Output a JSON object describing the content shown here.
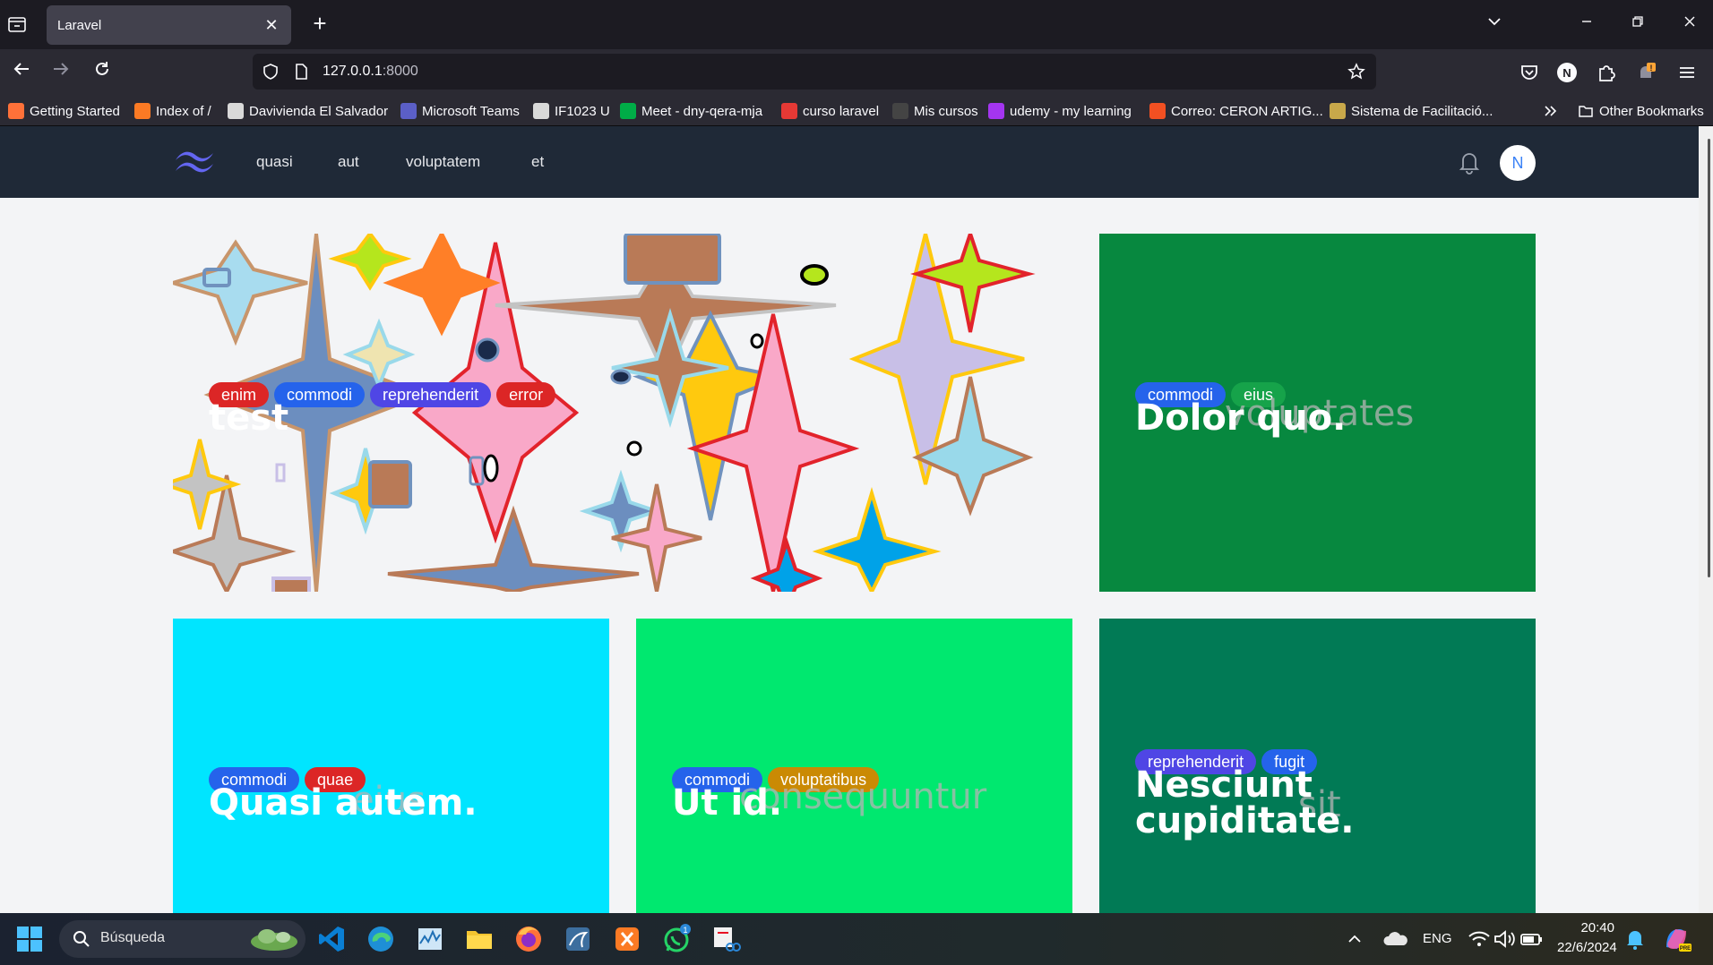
{
  "browser": {
    "tab_title": "Laravel",
    "url_host": "127.0.0.1",
    "url_port": ":8000",
    "bookmarks": [
      {
        "label": "Getting Started",
        "color": "#ff7139"
      },
      {
        "label": "Index of /",
        "color": "#fb7a24"
      },
      {
        "label": "Davivienda El Salvador",
        "color": "#d9d9d9"
      },
      {
        "label": "Microsoft Teams",
        "color": "#5b5fc7"
      },
      {
        "label": "IF1023 U",
        "color": "#d9d9d9"
      },
      {
        "label": "Meet - dny-qera-mja",
        "color": "#00ac47"
      },
      {
        "label": "curso laravel",
        "color": "#e53935"
      },
      {
        "label": "Mis cursos",
        "color": "#444444"
      },
      {
        "label": "udemy - my learning",
        "color": "#a435f0"
      },
      {
        "label": "Correo: CERON ARTIG...",
        "color": "#f25022"
      },
      {
        "label": "Sistema de Facilitació...",
        "color": "#c8a84a"
      }
    ],
    "other_bookmarks": "Other Bookmarks"
  },
  "app": {
    "nav_links": [
      "quasi",
      "aut",
      "voluptatem",
      "et"
    ],
    "avatar_initial": "N",
    "logo_color": "#6366f1"
  },
  "posts": [
    {
      "title": "test",
      "ghost": "",
      "bg": "image",
      "tags": [
        {
          "label": "enim",
          "color": "#dc2626"
        },
        {
          "label": "commodi",
          "color": "#2563eb"
        },
        {
          "label": "reprehenderit",
          "color": "#4f46e5"
        },
        {
          "label": "error",
          "color": "#dc2626"
        }
      ]
    },
    {
      "title": "Dolor quo.",
      "ghost": "voluptates",
      "bg": "#07883f",
      "tags": [
        {
          "label": "commodi",
          "color": "#2563eb"
        },
        {
          "label": "eius",
          "color": "#16a34a"
        }
      ]
    },
    {
      "title": "Quasi autem.",
      "ghost": "eius",
      "bg": "#00e5ff",
      "tags": [
        {
          "label": "commodi",
          "color": "#2563eb"
        },
        {
          "label": "quae",
          "color": "#dc2626"
        }
      ]
    },
    {
      "title": "Ut id.",
      "ghost": "consequuntur",
      "bg": "#00e86f",
      "tags": [
        {
          "label": "commodi",
          "color": "#2563eb"
        },
        {
          "label": "voluptatibus",
          "color": "#ca8a04"
        }
      ]
    },
    {
      "title": "Nesciunt cupiditate.",
      "ghost": "sit",
      "bg": "#017a55",
      "tags": [
        {
          "label": "reprehenderit",
          "color": "#4f46e5"
        },
        {
          "label": "fugit",
          "color": "#2563eb"
        }
      ]
    }
  ],
  "taskbar": {
    "search_placeholder": "Búsqueda",
    "language": "ENG",
    "time": "20:40",
    "date": "22/6/2024",
    "whatsapp_badge": "1"
  }
}
